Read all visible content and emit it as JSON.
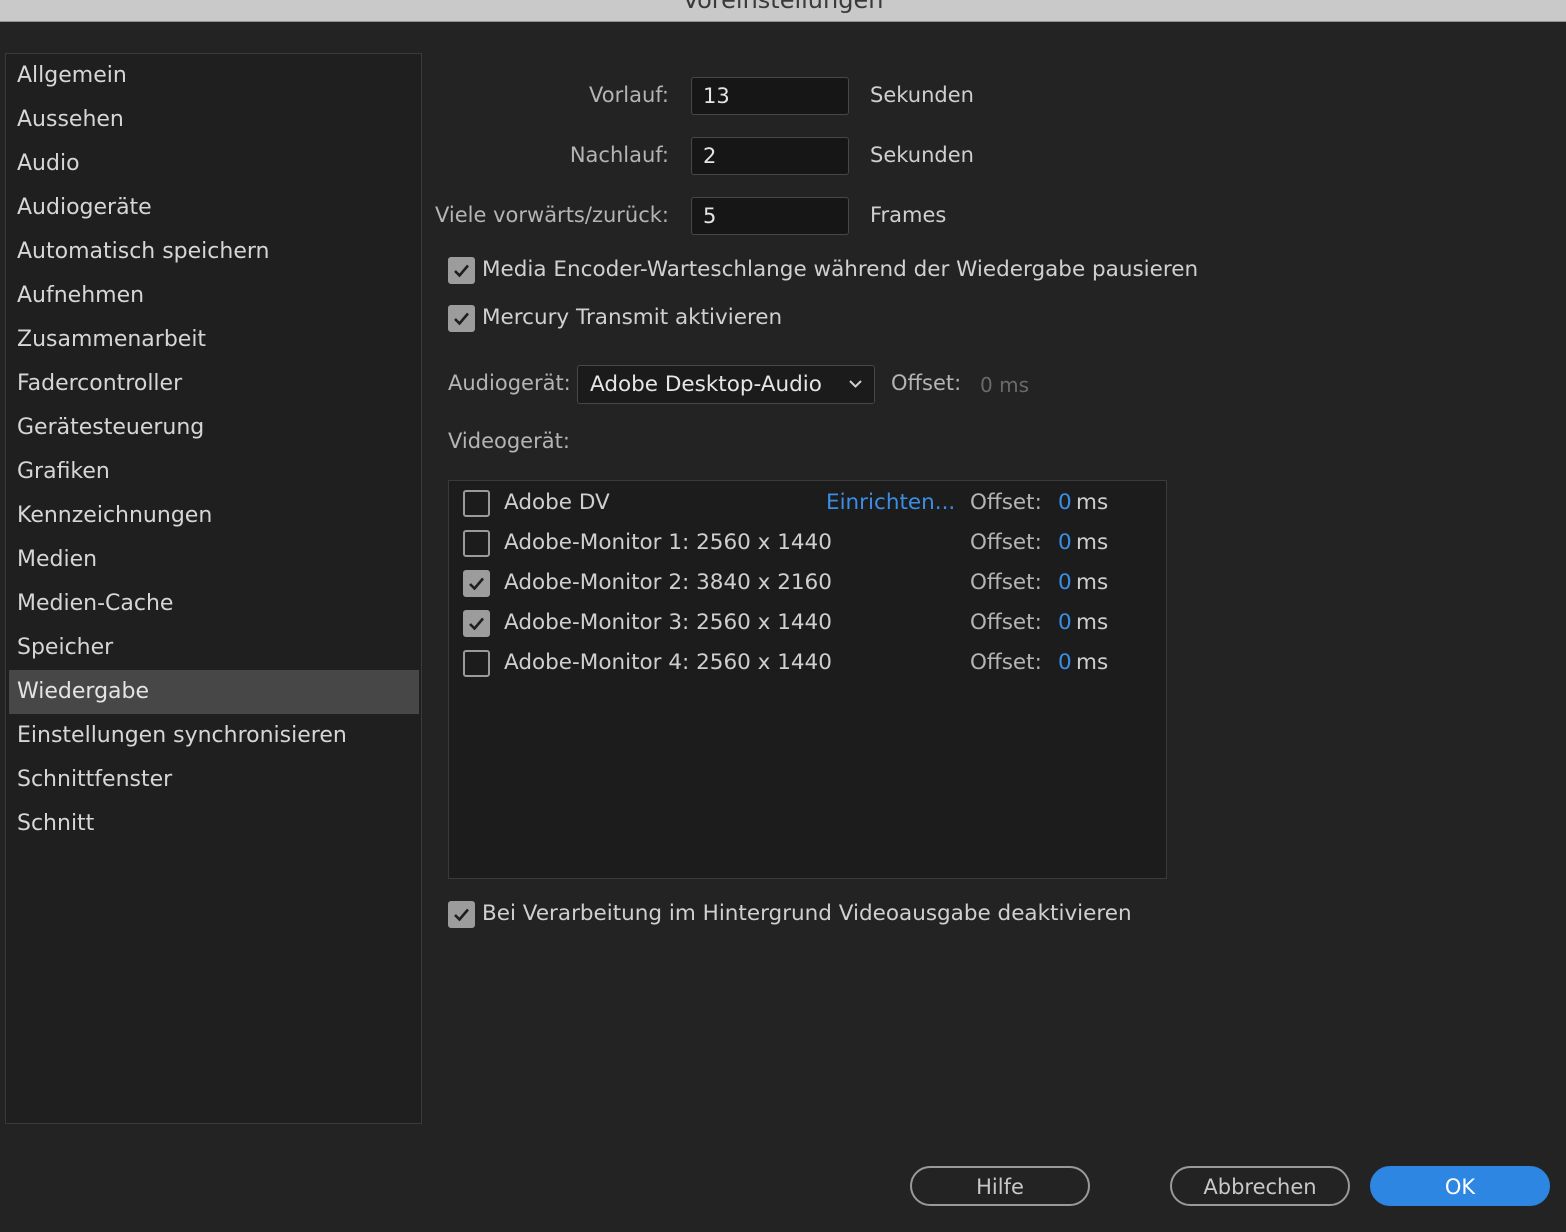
{
  "window": {
    "title": "Voreinstellungen"
  },
  "sidebar": {
    "items": [
      {
        "label": "Allgemein"
      },
      {
        "label": "Aussehen"
      },
      {
        "label": "Audio"
      },
      {
        "label": "Audiogeräte"
      },
      {
        "label": "Automatisch speichern"
      },
      {
        "label": "Aufnehmen"
      },
      {
        "label": "Zusammenarbeit"
      },
      {
        "label": "Fadercontroller"
      },
      {
        "label": "Gerätesteuerung"
      },
      {
        "label": "Grafiken"
      },
      {
        "label": "Kennzeichnungen"
      },
      {
        "label": "Medien"
      },
      {
        "label": "Medien-Cache"
      },
      {
        "label": "Speicher"
      },
      {
        "label": "Wiedergabe"
      },
      {
        "label": "Einstellungen synchronisieren"
      },
      {
        "label": "Schnittfenster"
      },
      {
        "label": "Schnitt"
      }
    ],
    "active": "Wiedergabe"
  },
  "playback": {
    "preroll": {
      "label": "Vorlauf:",
      "value": "13",
      "unit": "Sekunden"
    },
    "postroll": {
      "label": "Nachlauf:",
      "value": "2",
      "unit": "Sekunden"
    },
    "step": {
      "label": "Viele vorwärts/zurück:",
      "value": "5",
      "unit": "Frames"
    },
    "pause_media_encoder": {
      "label": "Media Encoder-Warteschlange während der Wiedergabe pausieren",
      "checked": true
    },
    "mercury_transmit": {
      "label": "Mercury Transmit aktivieren",
      "checked": true
    },
    "audio_device": {
      "label": "Audiogerät:",
      "value": "Adobe Desktop-Audio",
      "offset_label": "Offset:",
      "offset_value": "0 ms"
    },
    "video_device": {
      "label": "Videogerät:",
      "devices": [
        {
          "name": "Adobe DV",
          "checked": false,
          "action": "Einrichten...",
          "offset_label": "Offset:",
          "offset": "0",
          "unit": "ms"
        },
        {
          "name": "Adobe-Monitor 1: 2560 x 1440",
          "checked": false,
          "offset_label": "Offset:",
          "offset": "0",
          "unit": "ms"
        },
        {
          "name": "Adobe-Monitor 2: 3840 x 2160",
          "checked": true,
          "offset_label": "Offset:",
          "offset": "0",
          "unit": "ms"
        },
        {
          "name": "Adobe-Monitor 3: 2560 x 1440",
          "checked": true,
          "offset_label": "Offset:",
          "offset": "0",
          "unit": "ms"
        },
        {
          "name": "Adobe-Monitor 4: 2560 x 1440",
          "checked": false,
          "offset_label": "Offset:",
          "offset": "0",
          "unit": "ms"
        }
      ]
    },
    "disable_background_video": {
      "label": "Bei Verarbeitung im Hintergrund Videoausgabe deaktivieren",
      "checked": true
    }
  },
  "buttons": {
    "help": "Hilfe",
    "cancel": "Abbrechen",
    "ok": "OK"
  },
  "colors": {
    "accent": "#2c86e2",
    "link": "#3a8ee6",
    "background": "#232323",
    "sidebar_active": "#474747"
  },
  "icons": {
    "checkbox_check": "check-icon",
    "dropdown": "chevron-down-icon"
  }
}
